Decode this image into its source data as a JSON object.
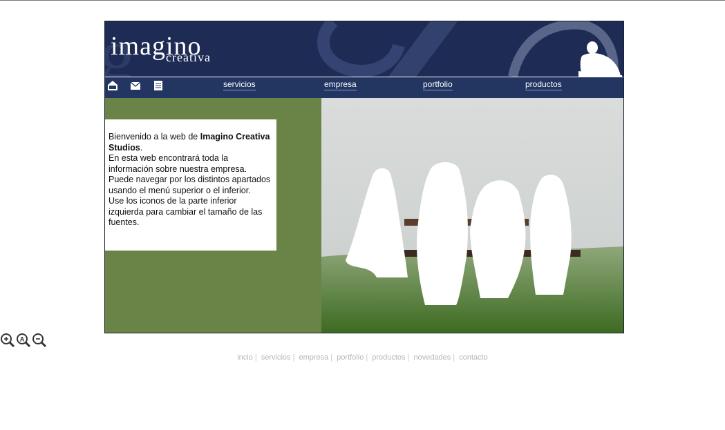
{
  "logo": {
    "main": "imagino",
    "sub": "creativa"
  },
  "nav": {
    "icons": [
      "home-icon",
      "mail-icon",
      "document-icon"
    ],
    "links": [
      "servicios",
      "empresa",
      "portfolio",
      "productos"
    ]
  },
  "welcome": {
    "line1_pre": "Bienvenido a la web de ",
    "line1_bold": "Imagino Creativa Studios",
    "line1_post": ".",
    "p2": "En esta web encontrará toda la información sobre nuestra empresa.",
    "p3": "Puede navegar por los distintos apartados usando el menú superior o el inferior.",
    "p4": "Use los iconos de la parte inferior izquierda para cambiar el tamaño de las fuentes."
  },
  "zoom": [
    "zoom-in-icon",
    "zoom-reset-icon",
    "zoom-out-icon"
  ],
  "footer": {
    "links": [
      "incio",
      "servicios",
      "empresa",
      "portfolio",
      "productos",
      "novedades",
      "contacto"
    ],
    "separator": "|"
  },
  "colors": {
    "header": "#1e2b54",
    "navbar": "#233561",
    "green": "#6a8448",
    "footer_text": "#b5b5b5"
  }
}
